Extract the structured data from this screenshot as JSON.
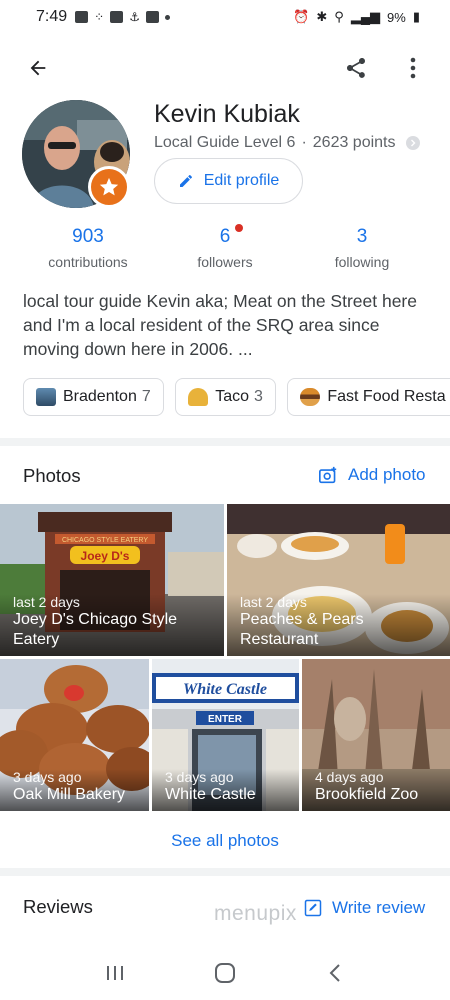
{
  "status_bar": {
    "time": "7:49",
    "battery": "9%"
  },
  "profile": {
    "name": "Kevin Kubiak",
    "level": "Local Guide Level 6",
    "separator": "·",
    "points": "2623 points",
    "edit_label": "Edit profile",
    "badge_icon": "local-guide-star-icon"
  },
  "stats": [
    {
      "value": "903",
      "label": "contributions"
    },
    {
      "value": "6",
      "label": "followers"
    },
    {
      "value": "3",
      "label": "following"
    }
  ],
  "bio": "local tour guide Kevin aka; Meat on the Street here and I'm a local resident of the SRQ area since moving down here in 2006. ...",
  "chips": [
    {
      "label": "Bradenton",
      "count": "7",
      "icon": "city-icon"
    },
    {
      "label": "Taco",
      "count": "3",
      "icon": "taco-icon"
    },
    {
      "label": "Fast Food Resta",
      "count": "",
      "icon": "burger-icon"
    }
  ],
  "photos": {
    "title": "Photos",
    "add_label": "Add photo",
    "tiles": [
      {
        "when": "last 2 days",
        "title": "Joey D's Chicago Style Eatery"
      },
      {
        "when": "last 2 days",
        "title": "Peaches & Pears Restaurant"
      },
      {
        "when": "3 days ago",
        "title": "Oak Mill Bakery"
      },
      {
        "when": "3 days ago",
        "title": "White Castle"
      },
      {
        "when": "4 days ago",
        "title": "Brookfield Zoo"
      }
    ],
    "see_all": "See all photos",
    "sign_texts": {
      "joey": "Joey D's",
      "chicago": "CHICAGO STYLE EATERY",
      "white_castle": "White Castle",
      "enter": "ENTER"
    }
  },
  "reviews": {
    "title": "Reviews",
    "write_label": "Write review"
  },
  "watermark": "menupix",
  "colors": {
    "accent": "#1a73e8",
    "badge": "#e8711a",
    "notification": "#d93025"
  }
}
